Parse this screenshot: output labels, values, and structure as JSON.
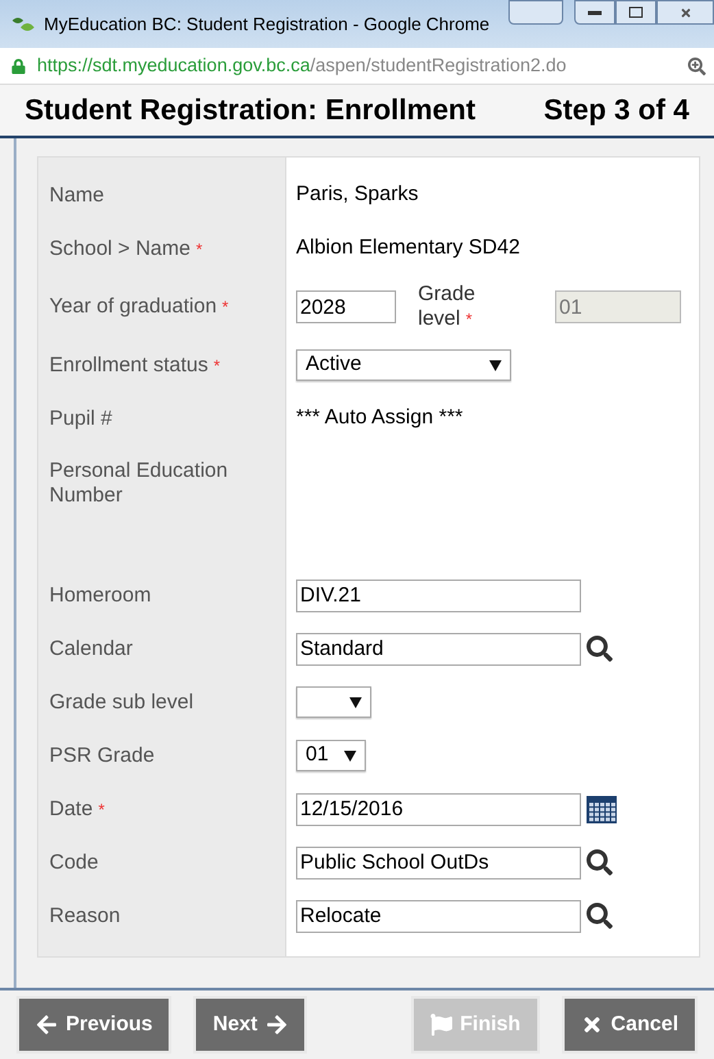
{
  "window": {
    "title": "MyEducation BC: Student Registration - Google Chrome"
  },
  "address_bar": {
    "host": "https://sdt.myeducation.gov.bc.ca",
    "path": "/aspen/studentRegistration2.do"
  },
  "header": {
    "title": "Student Registration: Enrollment",
    "step": "Step 3 of 4"
  },
  "form": {
    "rows": [
      {
        "kind": "text",
        "label": "Name",
        "value": "Paris, Sparks"
      },
      {
        "kind": "text",
        "label": "School > Name",
        "required_mark": "*",
        "value": "Albion Elementary SD42"
      },
      {
        "kind": "grade",
        "label": "Year of graduation",
        "required_mark": "*",
        "value": "2028",
        "secondary_label": "Grade level",
        "secondary_required_mark": "*",
        "secondary_value": "01",
        "secondary_disabled": true
      },
      {
        "kind": "wide_select",
        "label": "Enrollment status",
        "required_mark": "*",
        "value": "Active"
      },
      {
        "kind": "text",
        "label": "Pupil #",
        "value": "*** Auto Assign ***"
      },
      {
        "kind": "empty",
        "label": "Personal Education Number"
      },
      {
        "kind": "input",
        "label": "Homeroom",
        "value": "DIV.21"
      },
      {
        "kind": "lookup",
        "label": "Calendar",
        "value": "Standard"
      },
      {
        "kind": "select",
        "label": "Grade sub level"
      },
      {
        "kind": "select",
        "label": "PSR Grade",
        "value": "01"
      },
      {
        "kind": "date",
        "label": "Date",
        "required_mark": "*",
        "value": "12/15/2016"
      },
      {
        "kind": "lookup",
        "label": "Code",
        "value": "Public School OutDs"
      },
      {
        "kind": "lookup",
        "label": "Reason",
        "value": "Relocate"
      }
    ]
  },
  "buttons": [
    {
      "kind": "previous",
      "label": "Previous",
      "disabled": false
    },
    {
      "kind": "next",
      "label": "Next",
      "disabled": false
    },
    {
      "kind": "finish",
      "label": "Finish",
      "disabled": true
    },
    {
      "kind": "cancel",
      "label": "Cancel",
      "disabled": false
    }
  ]
}
